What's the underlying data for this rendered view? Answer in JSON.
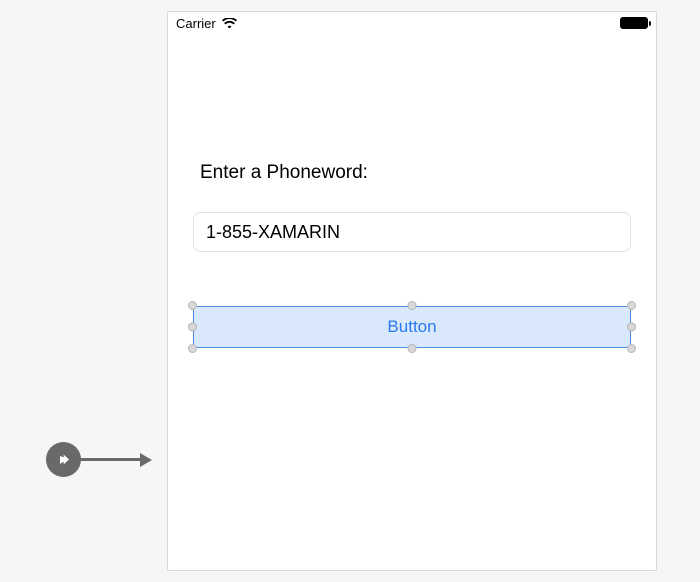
{
  "statusBar": {
    "carrier": "Carrier"
  },
  "form": {
    "heading": "Enter a Phoneword:",
    "inputValue": "1-855-XAMARIN",
    "buttonLabel": "Button"
  }
}
